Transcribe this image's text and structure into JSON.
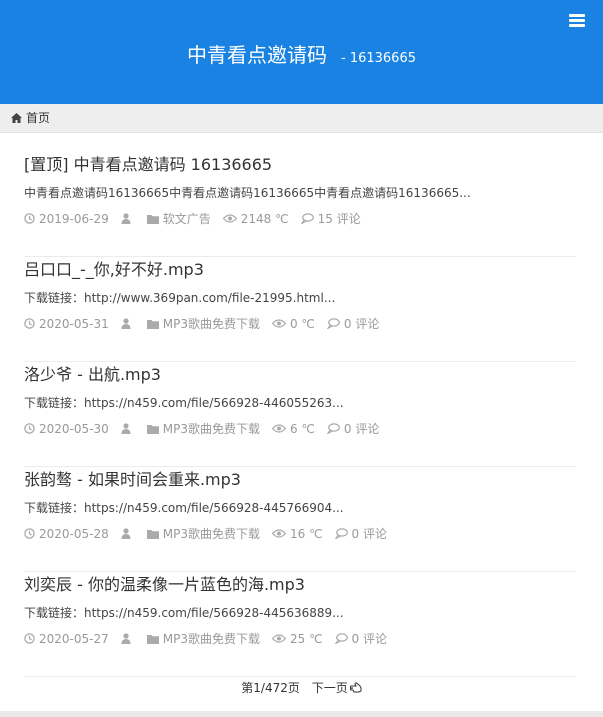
{
  "header": {
    "site_name": "中青看点邀请码",
    "site_desc": "- 16136665"
  },
  "breadcrumb": {
    "home": "首页"
  },
  "articles": [
    {
      "title": "[置顶] 中青看点邀请码 16136665",
      "excerpt": "中青看点邀请码16136665中青看点邀请码16136665中青看点邀请码16136665...",
      "date": "2019-06-29",
      "category": "软文广告",
      "views": "2148 ℃",
      "comments": "15 评论"
    },
    {
      "title": "吕口口_-_你,好不好.mp3",
      "excerpt": "下载链接：http://www.369pan.com/file-21995.html...",
      "date": "2020-05-31",
      "category": "MP3歌曲免费下载",
      "views": "0 ℃",
      "comments": "0 评论"
    },
    {
      "title": "洛少爷 - 出航.mp3",
      "excerpt": "下载链接：https://n459.com/file/566928-446055263...",
      "date": "2020-05-30",
      "category": "MP3歌曲免费下载",
      "views": "6 ℃",
      "comments": "0 评论"
    },
    {
      "title": "张韵骜 - 如果时间会重来.mp3",
      "excerpt": "下载链接：https://n459.com/file/566928-445766904...",
      "date": "2020-05-28",
      "category": "MP3歌曲免费下载",
      "views": "16 ℃",
      "comments": "0 评论"
    },
    {
      "title": "刘奕辰 - 你的温柔像一片蓝色的海.mp3",
      "excerpt": "下载链接：https://n459.com/file/566928-445636889...",
      "date": "2020-05-27",
      "category": "MP3歌曲免费下载",
      "views": "25 ℃",
      "comments": "0 评论"
    }
  ],
  "pagination": {
    "page_info": "第1/472页",
    "next_label": "下一页"
  },
  "icons": {
    "menu": "hamburger-menu-icon",
    "home": "home-icon",
    "date": "clock-icon",
    "author": "user-icon",
    "category": "folder-icon",
    "views": "eye-icon",
    "comments": "comment-icon",
    "next": "hand-pointer-icon"
  },
  "colors": {
    "header_bg": "#1a82e2",
    "breadcrumb_bg": "#eeeeee",
    "meta_text": "#999999"
  }
}
